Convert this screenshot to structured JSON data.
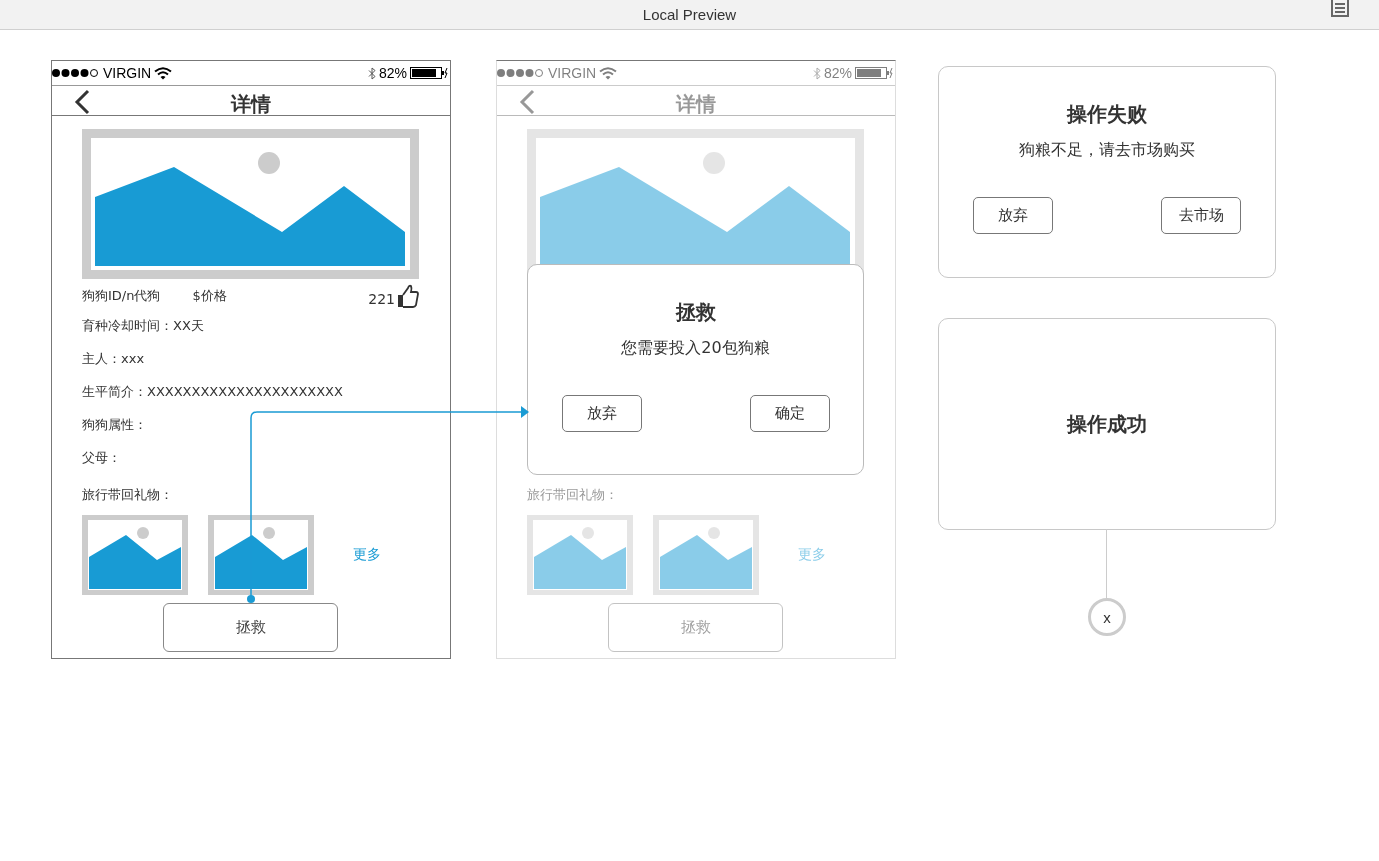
{
  "window": {
    "title": "Local Preview"
  },
  "screens": [
    {
      "faded": false,
      "status_bar": {
        "carrier": "VIRGIN",
        "battery": "82%"
      },
      "nav": {
        "title": "详情"
      },
      "info": {
        "id": "狗狗ID/n代狗",
        "price": "$价格",
        "likes": "221"
      },
      "fields": [
        "育种冷却时间：XX天",
        "主人：xxx",
        "生平简介：XXXXXXXXXXXXXXXXXXXXXX",
        "狗狗属性：",
        "父母："
      ],
      "gifts_label": "旅行带回礼物：",
      "more": "更多",
      "action": "拯救"
    },
    {
      "faded": true,
      "status_bar": {
        "carrier": "VIRGIN",
        "battery": "82%"
      },
      "nav": {
        "title": "详情"
      },
      "gifts_label": "旅行带回礼物：",
      "more": "更多",
      "action": "拯救",
      "dialog": {
        "title": "拯救",
        "message": "您需要投入20包狗粮",
        "buttons": [
          "放弃",
          "确定"
        ]
      }
    }
  ],
  "cards": [
    {
      "title": "操作失败",
      "message": "狗粮不足，请去市场购买",
      "buttons": [
        "放弃",
        "去市场"
      ]
    },
    {
      "title": "操作成功"
    }
  ],
  "close_button": "x"
}
